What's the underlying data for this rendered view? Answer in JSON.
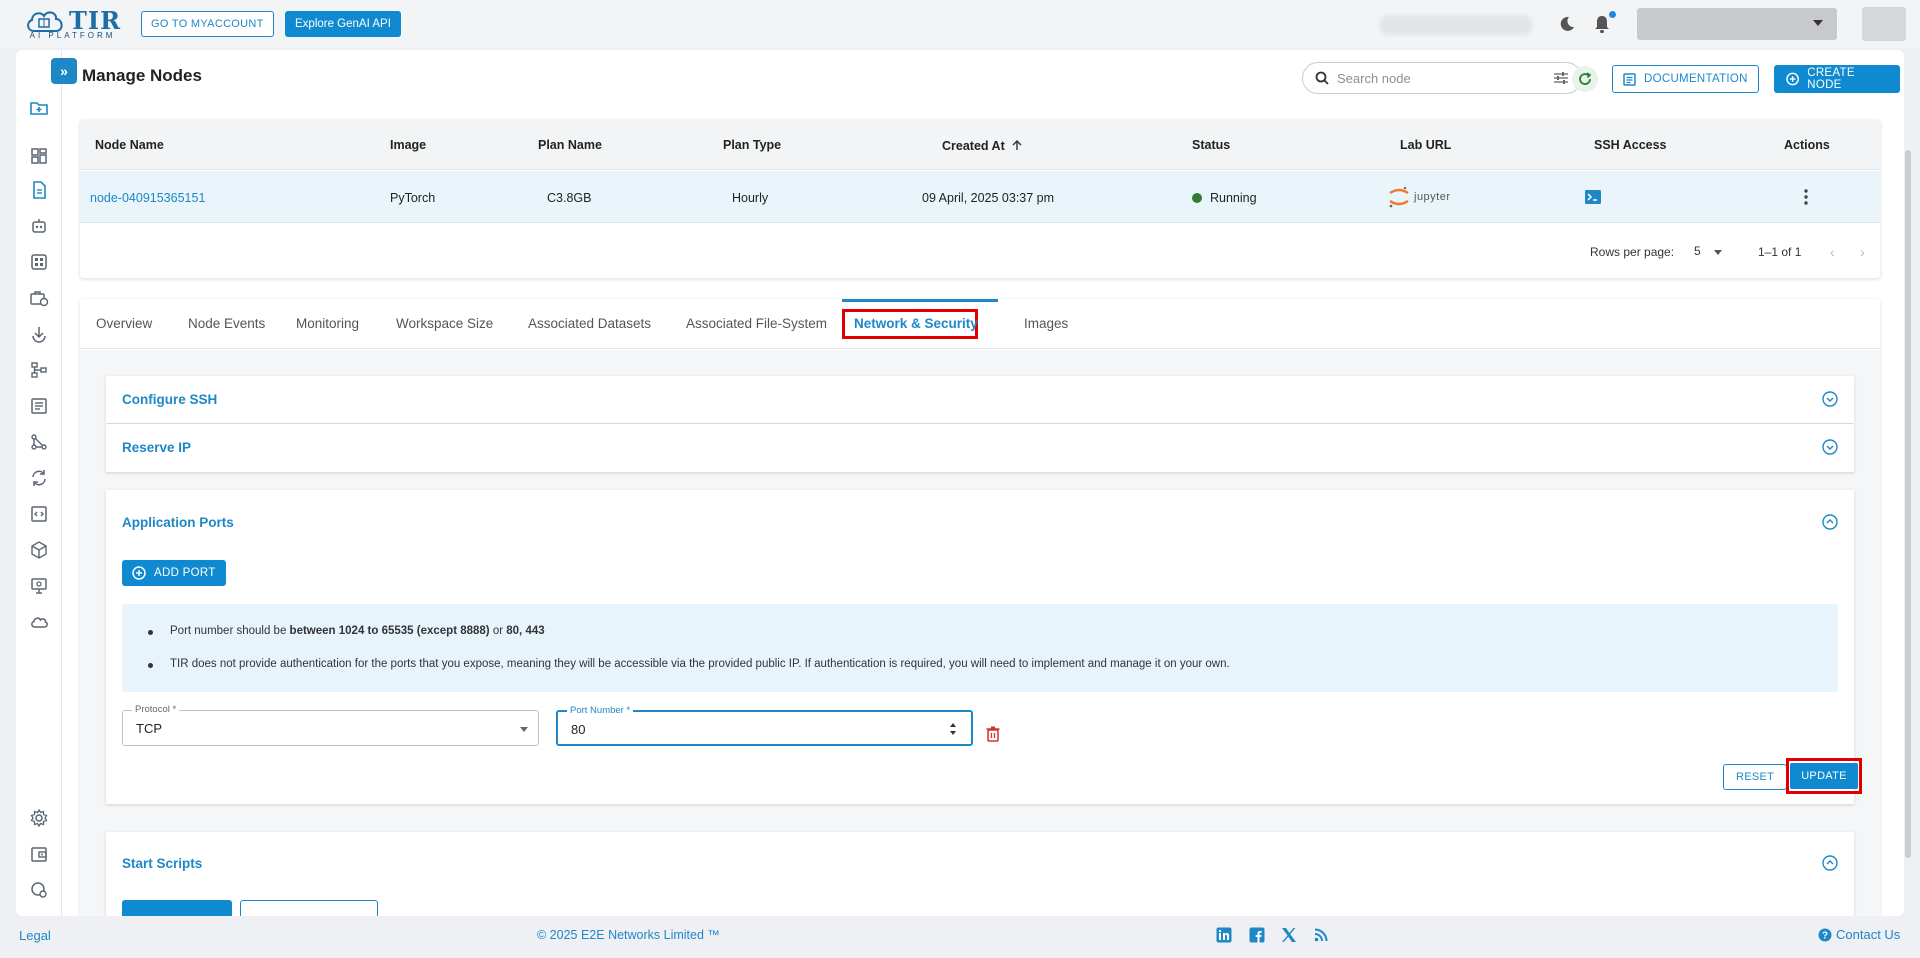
{
  "topbar": {
    "logo_text": "TIR",
    "logo_sub": "AI PLATFORM",
    "myaccount_label": "GO TO MYACCOUNT",
    "genai_label": "Explore GenAI API"
  },
  "header": {
    "title": "Manage Nodes",
    "search_placeholder": "Search node",
    "documentation_label": "DOCUMENTATION",
    "create_label": "CREATE NODE"
  },
  "table": {
    "columns": [
      "Node Name",
      "Image",
      "Plan Name",
      "Plan Type",
      "Created At",
      "Status",
      "Lab URL",
      "SSH Access",
      "Actions"
    ],
    "rows": [
      {
        "node_name": "node-040915365151",
        "image": "PyTorch",
        "plan_name": "C3.8GB",
        "plan_type": "Hourly",
        "created_at": "09 April, 2025 03:37 pm",
        "status": "Running",
        "lab_url": "jupyter"
      }
    ],
    "rows_per_page_label": "Rows per page:",
    "rows_per_page_value": "5",
    "range_label": "1–1 of 1"
  },
  "tabs": {
    "items": [
      "Overview",
      "Node Events",
      "Monitoring",
      "Workspace Size",
      "Associated Datasets",
      "Associated File-System",
      "Network & Security",
      "Images"
    ],
    "active": "Network & Security"
  },
  "sections": {
    "configure_ssh": "Configure SSH",
    "reserve_ip": "Reserve IP",
    "application_ports": "Application Ports",
    "start_scripts": "Start Scripts"
  },
  "ports": {
    "add_port_label": "ADD PORT",
    "info_1_prefix": "Port number should be ",
    "info_1_bold": "between 1024 to 65535 (except 8888)",
    "info_1_mid": " or ",
    "info_1_bold2": "80, 443",
    "info_2": "TIR does not provide authentication for the ports that you expose, meaning they will be accessible via the provided public IP. If authentication is required, you will need to implement and manage it on your own.",
    "protocol_label": "Protocol *",
    "protocol_value": "TCP",
    "port_label": "Port Number *",
    "port_value": "80",
    "reset_label": "RESET",
    "update_label": "UPDATE"
  },
  "footer": {
    "legal": "Legal",
    "copyright": "© 2025 E2E Networks Limited ™",
    "contact": "Contact Us"
  },
  "colors": {
    "accent": "#1e88c7",
    "highlight": "#e00000",
    "running": "#2e7d32"
  }
}
